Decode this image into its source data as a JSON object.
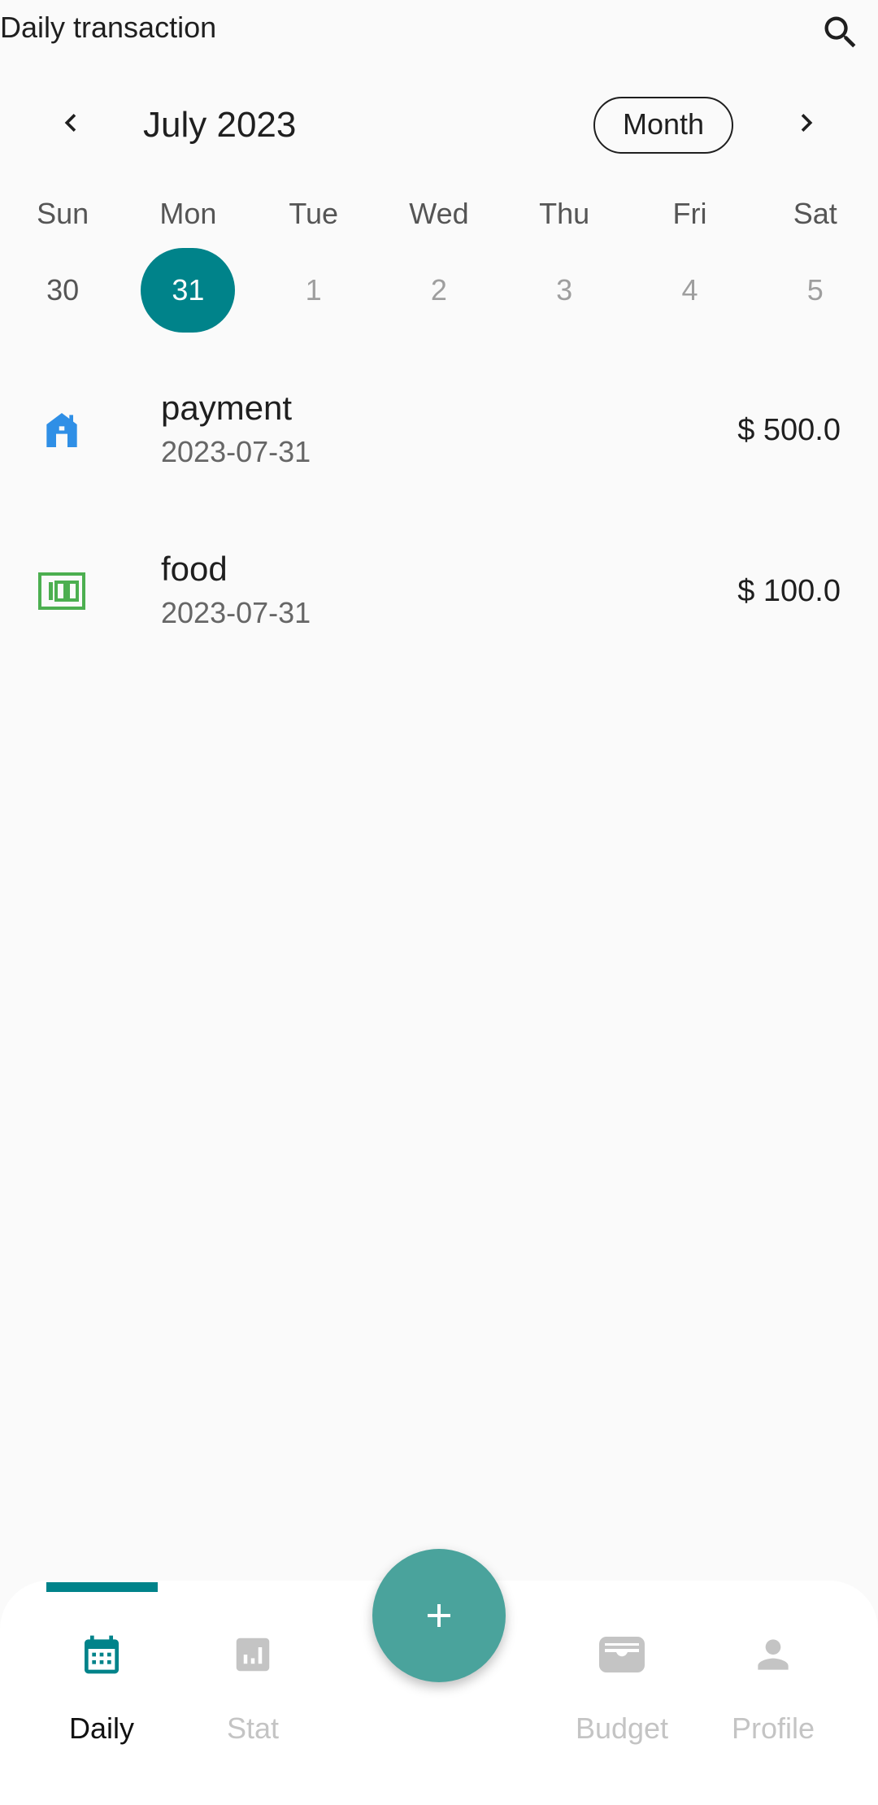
{
  "header": {
    "title": "Daily transaction",
    "search_icon": "search-icon"
  },
  "calendar": {
    "month_label": "July 2023",
    "view_mode": "Month",
    "prev_icon": "chevron-left-icon",
    "next_icon": "chevron-right-icon",
    "weekdays": [
      "Sun",
      "Mon",
      "Tue",
      "Wed",
      "Thu",
      "Fri",
      "Sat"
    ],
    "days": [
      "30",
      "31",
      "1",
      "2",
      "3",
      "4",
      "5"
    ],
    "selected_day": "31",
    "selected_color": "#00838a"
  },
  "transactions": [
    {
      "title": "payment",
      "date": "2023-07-31",
      "amount": "$ 500.0",
      "icon": "home-icon",
      "icon_color": "#2f8fe6"
    },
    {
      "title": "food",
      "date": "2023-07-31",
      "amount": "$ 100.0",
      "icon": "money-icon",
      "icon_color": "#4caf50"
    }
  ],
  "bottom_nav": {
    "items": [
      {
        "label": "Daily",
        "icon": "calendar-icon",
        "active": true
      },
      {
        "label": "Stat",
        "icon": "bar-chart-icon",
        "active": false
      },
      {
        "label": "Budget",
        "icon": "wallet-icon",
        "active": false
      },
      {
        "label": "Profile",
        "icon": "person-icon",
        "active": false
      }
    ],
    "fab_icon": "plus-icon",
    "accent_color": "#00838a",
    "fab_color": "#4aa39c"
  }
}
